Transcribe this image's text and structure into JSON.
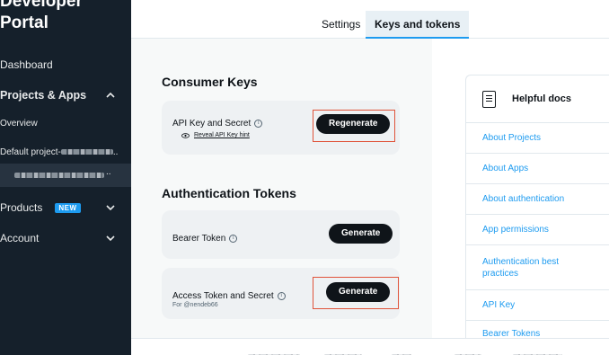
{
  "sidebar": {
    "brand_line1": "Developer",
    "brand_line2": "Portal",
    "dashboard": "Dashboard",
    "projects_apps": "Projects & Apps",
    "overview": "Overview",
    "default_project": "Default project-",
    "products": "Products",
    "products_badge": "NEW",
    "account": "Account"
  },
  "tabs": {
    "settings": "Settings",
    "keys_and_tokens": "Keys and tokens"
  },
  "consumer_keys": {
    "title": "Consumer Keys",
    "api_key_label": "API Key and Secret",
    "reveal_hint": "Reveal API Key hint",
    "regenerate": "Regenerate"
  },
  "auth_tokens": {
    "title": "Authentication Tokens",
    "bearer_label": "Bearer Token",
    "bearer_button": "Generate",
    "access_label": "Access Token and Secret",
    "access_sub": "For @nendeb66",
    "access_button": "Generate"
  },
  "helpful_docs": {
    "title": "Helpful docs",
    "links": [
      "About Projects",
      "About Apps",
      "About authentication",
      "App permissions",
      "Authentication best practices",
      "API Key",
      "Bearer Tokens"
    ]
  },
  "colors": {
    "sidebar_bg": "#15202b",
    "accent": "#1d9bf0",
    "highlight": "#e0533a",
    "button": "#0f1419"
  },
  "icons": [
    "chevron-up-icon",
    "chevron-down-icon",
    "info-icon",
    "eye-icon",
    "document-icon"
  ]
}
